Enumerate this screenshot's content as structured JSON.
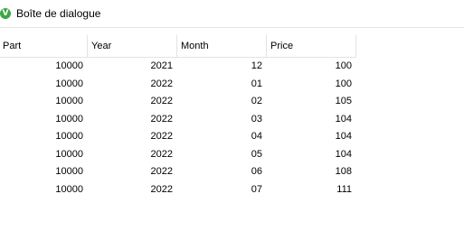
{
  "window": {
    "title": "Boîte de dialogue",
    "icon": "app-logo-icon",
    "icon_glyph": "V",
    "accent_color": "#3aa843"
  },
  "table": {
    "columns": [
      "Part",
      "Year",
      "Month",
      "Price"
    ],
    "rows": [
      [
        "10000",
        "2021",
        "12",
        "100"
      ],
      [
        "10000",
        "2022",
        "01",
        "100"
      ],
      [
        "10000",
        "2022",
        "02",
        "105"
      ],
      [
        "10000",
        "2022",
        "03",
        "104"
      ],
      [
        "10000",
        "2022",
        "04",
        "104"
      ],
      [
        "10000",
        "2022",
        "05",
        "104"
      ],
      [
        "10000",
        "2022",
        "06",
        "108"
      ],
      [
        "10000",
        "2022",
        "07",
        "111"
      ]
    ]
  }
}
